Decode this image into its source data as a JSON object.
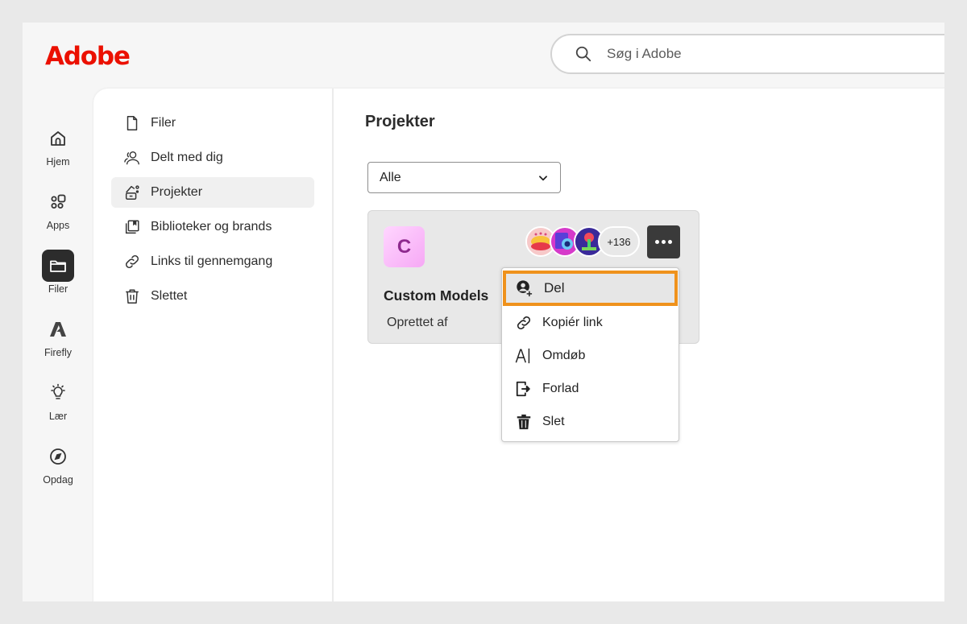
{
  "brand": {
    "logo_text": "Adobe",
    "color": "#eb1000"
  },
  "search": {
    "placeholder": "Søg i Adobe",
    "value": "",
    "icon": "search-icon"
  },
  "rail": {
    "items": [
      {
        "label": "Hjem",
        "icon": "home-icon",
        "active": false
      },
      {
        "label": "Apps",
        "icon": "apps-icon",
        "active": false
      },
      {
        "label": "Filer",
        "icon": "folder-icon",
        "active": true
      },
      {
        "label": "Firefly",
        "icon": "firefly-icon",
        "active": false
      },
      {
        "label": "Lær",
        "icon": "lightbulb-icon",
        "active": false
      },
      {
        "label": "Opdag",
        "icon": "compass-icon",
        "active": false
      }
    ]
  },
  "subnav": {
    "items": [
      {
        "label": "Filer",
        "icon": "file-icon",
        "active": false
      },
      {
        "label": "Delt med dig",
        "icon": "people-icon",
        "active": false
      },
      {
        "label": "Projekter",
        "icon": "projects-icon",
        "active": true
      },
      {
        "label": "Biblioteker og brands",
        "icon": "libraries-icon",
        "active": false
      },
      {
        "label": "Links til gennemgang",
        "icon": "link-icon",
        "active": false
      },
      {
        "label": "Slettet",
        "icon": "trash-icon",
        "active": false
      }
    ]
  },
  "main": {
    "title": "Projekter",
    "filter": {
      "selected": "Alle"
    },
    "card": {
      "thumb_letter": "C",
      "title": "Custom Models",
      "subtitle": "Oprettet af",
      "avatar_overflow": "+136",
      "more_label": "Flere handlinger"
    },
    "menu": {
      "items": [
        {
          "label": "Del",
          "icon": "share-user-icon",
          "highlighted": true
        },
        {
          "label": "Kopiér link",
          "icon": "link-icon"
        },
        {
          "label": "Omdøb",
          "icon": "rename-icon"
        },
        {
          "label": "Forlad",
          "icon": "leave-icon"
        },
        {
          "label": "Slet",
          "icon": "trash-icon"
        }
      ],
      "highlight_color": "#ef921c"
    }
  }
}
